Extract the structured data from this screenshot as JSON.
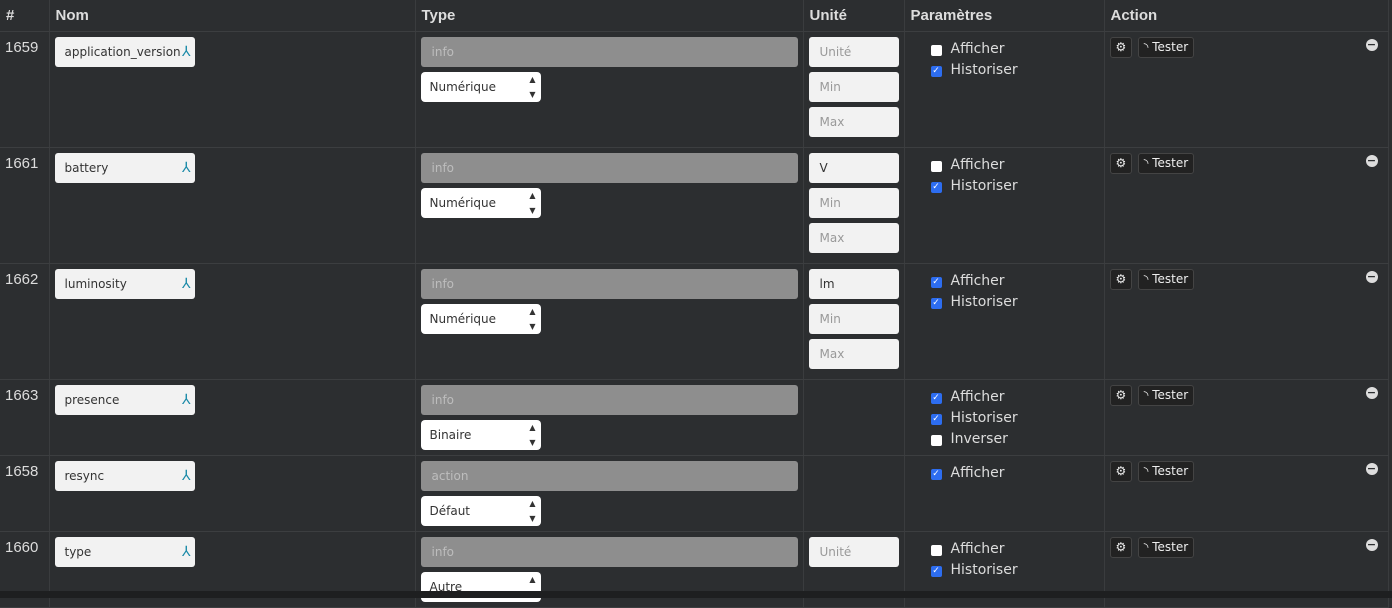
{
  "headers": {
    "id": "#",
    "name": "Nom",
    "type": "Type",
    "unit": "Unité",
    "params": "Paramètres",
    "action": "Action"
  },
  "placeholders": {
    "unit": "Unité",
    "min": "Min",
    "max": "Max"
  },
  "labels": {
    "afficher": "Afficher",
    "historiser": "Historiser",
    "inverser": "Inverser",
    "tester": "Tester"
  },
  "rows": [
    {
      "id": "1659",
      "name": "application_version",
      "type": "info",
      "subtype": "Numérique",
      "unit": "",
      "minmax": true,
      "afficher": false,
      "historiser": true
    },
    {
      "id": "1661",
      "name": "battery",
      "type": "info",
      "subtype": "Numérique",
      "unit": "V",
      "minmax": true,
      "afficher": false,
      "historiser": true
    },
    {
      "id": "1662",
      "name": "luminosity",
      "type": "info",
      "subtype": "Numérique",
      "unit": "lm",
      "minmax": true,
      "afficher": true,
      "historiser": true
    },
    {
      "id": "1663",
      "name": "presence",
      "type": "info",
      "subtype": "Binaire",
      "afficher": true,
      "historiser": true,
      "inverser": false
    },
    {
      "id": "1658",
      "name": "resync",
      "type": "action",
      "subtype": "Défaut",
      "afficher": true
    },
    {
      "id": "1660",
      "name": "type",
      "type": "info",
      "subtype": "Autre",
      "unit": "",
      "afficher": false,
      "historiser": true
    }
  ],
  "colors": {
    "checkbox": "#2d6df0",
    "name_icon": "#1a8aa8"
  }
}
